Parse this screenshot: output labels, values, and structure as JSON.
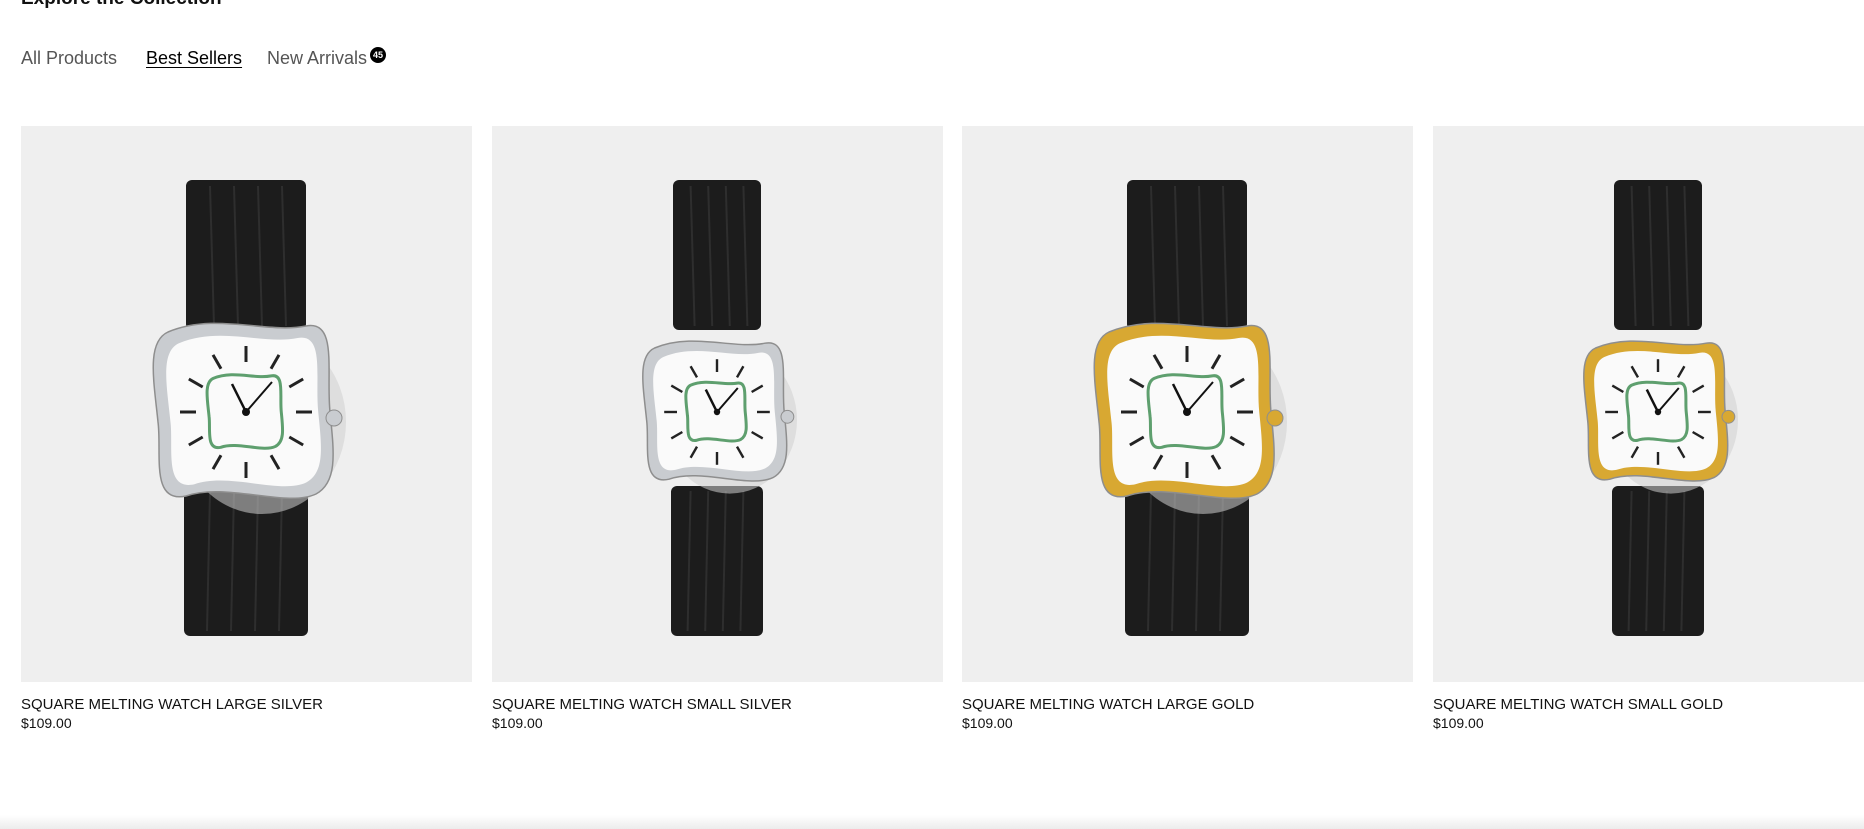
{
  "section": {
    "title": "Explore the Collection"
  },
  "tabs": [
    {
      "label": "All Products",
      "active": false
    },
    {
      "label": "Best Sellers",
      "active": true
    },
    {
      "label": "New Arrivals",
      "active": false,
      "badge": "45"
    }
  ],
  "products": [
    {
      "name": "SQUARE MELTING WATCH LARGE SILVER",
      "price": "$109.00",
      "metal": "silver",
      "size": "large"
    },
    {
      "name": "SQUARE MELTING WATCH SMALL SILVER",
      "price": "$109.00",
      "metal": "silver",
      "size": "small"
    },
    {
      "name": "SQUARE MELTING WATCH LARGE GOLD",
      "price": "$109.00",
      "metal": "gold",
      "size": "large"
    },
    {
      "name": "SQUARE MELTING WATCH SMALL GOLD",
      "price": "$109.00",
      "metal": "gold",
      "size": "small"
    }
  ],
  "colors": {
    "card_background": "#efefef",
    "strap": "#1c1c1c",
    "silver": "#c9ccd0",
    "gold": "#d8a832",
    "inner_track": "#5e9f6e",
    "dial": "#fafafa"
  }
}
